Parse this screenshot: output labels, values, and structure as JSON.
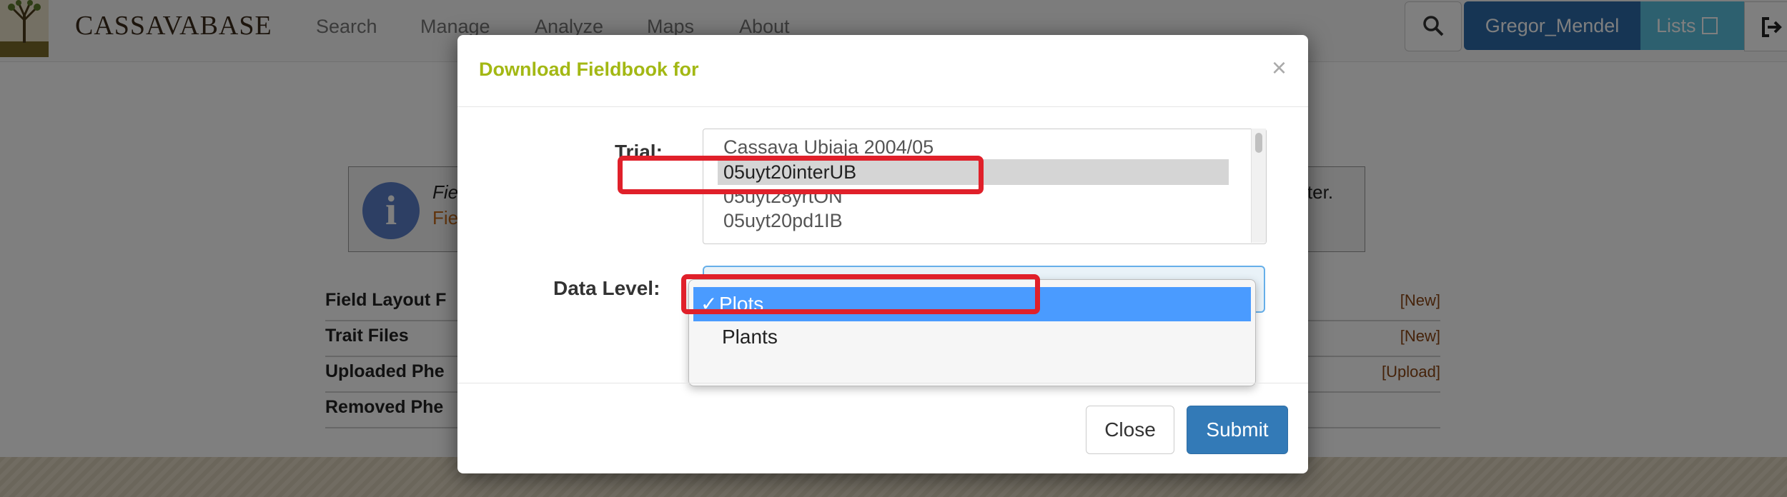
{
  "navbar": {
    "brand": "CASSAVABASE",
    "items": [
      "Search",
      "Manage",
      "Analyze",
      "Maps",
      "About"
    ],
    "user": "Gregor_Mendel",
    "lists_label": "Lists"
  },
  "page": {
    "info_line1": "Fie",
    "info_line2": "Fie",
    "info_line1_right": "puter.",
    "file_sections": [
      {
        "label": "Field Layout F",
        "action": "[New]"
      },
      {
        "label": "Trait Files",
        "action": "[New]"
      },
      {
        "label": "Uploaded Phe",
        "action": "[Upload]"
      },
      {
        "label": "Removed Phe",
        "action": ""
      }
    ]
  },
  "modal": {
    "title": "Download Fieldbook for",
    "close_symbol": "×",
    "trial_label": "Trial:",
    "trial_options": [
      "Cassava Ubiaja 2004/05",
      "05uyt20interUB",
      "05uyt28yrtON",
      "05uyt20pd1IB"
    ],
    "trial_selected_index": 1,
    "data_level_label": "Data Level:",
    "data_level_options": [
      "Plots",
      "Plants"
    ],
    "data_level_selected_index": 0,
    "check_mark": "✓",
    "close_button": "Close",
    "submit_button": "Submit"
  },
  "colors": {
    "title": "#a3b814",
    "highlight": "#e0202a",
    "selected_option": "#4a9bff",
    "primary_button": "#337ab7",
    "user_button": "#2c6aa8",
    "lists_button": "#5bc0de"
  }
}
